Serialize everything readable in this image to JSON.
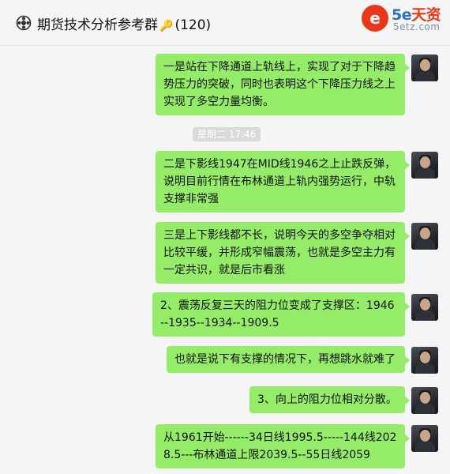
{
  "header": {
    "title": "期货技术分析参考群",
    "key_glyph": "🔑",
    "member_count": "(120)",
    "icon": "group-settings-icon"
  },
  "watermark": {
    "badge": "e",
    "brand_num": "5e",
    "brand_text": "天资",
    "domain": "5etz.com"
  },
  "timestamp": "星期二 17:46",
  "messages": [
    {
      "text": "一是站在下降通道上轨线上，实现了对于下降趋势压力的突破，同时也表明这个下降压力线之上实现了多空力量均衡。"
    },
    {
      "text": "二是下影线1947在MID线1946之上止跌反弹，说明目前行情在布林通道上轨内强势运行，中轨支撑非常强"
    },
    {
      "text": "三是上下影线都不长，说明今天的多空争夺相对比较平缓，并形成窄幅震荡，也就是多空主力有一定共识，就是后市看涨"
    },
    {
      "text": "2、震荡反复三天的阻力位变成了支撑区：1946--1935--1934--1909.5"
    },
    {
      "text": "也就是说下有支撑的情况下，再想跳水就难了"
    },
    {
      "text": "3、向上的阻力位相对分散。"
    },
    {
      "text": "从1961开始------34日线1995.5-----144线2028.5---布林通道上限2039.5--55日线2059"
    }
  ]
}
